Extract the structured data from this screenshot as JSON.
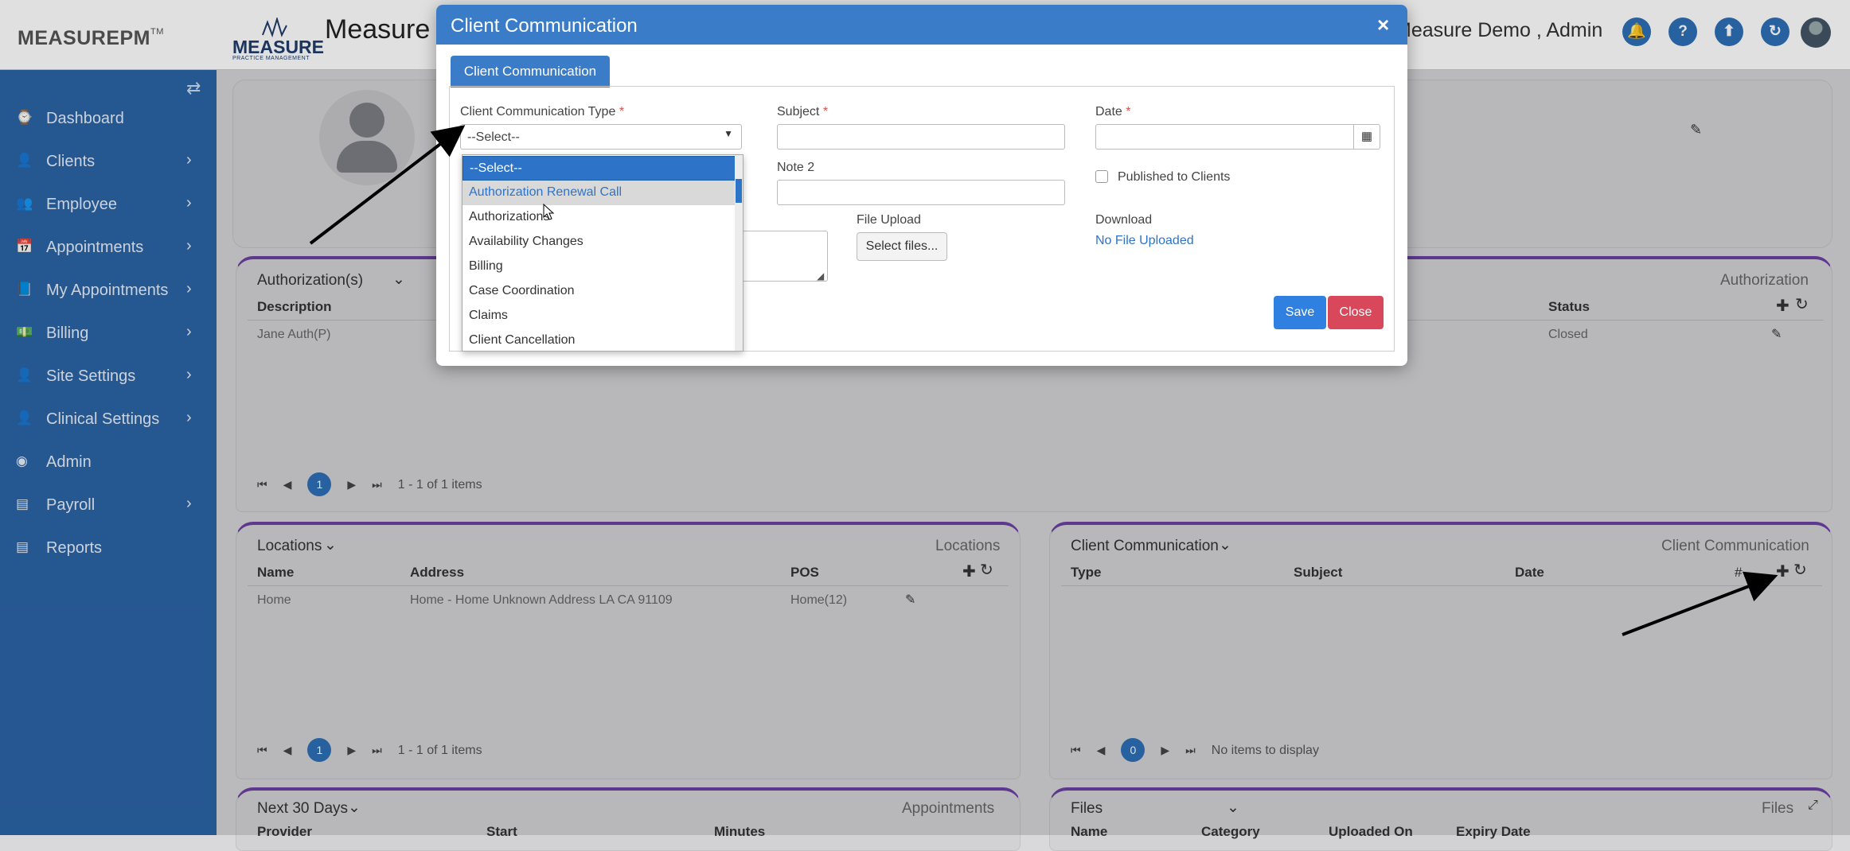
{
  "header": {
    "brand": "MEASUREPM",
    "brand_tm": "TM",
    "logo_word": "MEASURE",
    "logo_sub": "PRACTICE MANAGEMENT",
    "app_title": "Measure",
    "user_label": "Measure Demo , Admin",
    "icons": [
      "bell-icon",
      "help-icon",
      "upload-icon",
      "refresh-icon"
    ],
    "icon_glyphs": [
      "🔔",
      "?",
      "⬆",
      "↻"
    ]
  },
  "sidebar": {
    "items": [
      {
        "label": "Dashboard",
        "icon": "⌚",
        "chev": false
      },
      {
        "label": "Clients",
        "icon": "👤",
        "chev": true
      },
      {
        "label": "Employee",
        "icon": "👥",
        "chev": true
      },
      {
        "label": "Appointments",
        "icon": "📅",
        "chev": true
      },
      {
        "label": "My Appointments",
        "icon": "📘",
        "chev": true
      },
      {
        "label": "Billing",
        "icon": "💵",
        "chev": true
      },
      {
        "label": "Site Settings",
        "icon": "👤",
        "chev": true
      },
      {
        "label": "Clinical Settings",
        "icon": "👤",
        "chev": true
      },
      {
        "label": "Admin",
        "icon": "◉",
        "chev": false
      },
      {
        "label": "Payroll",
        "icon": "▤",
        "chev": true
      },
      {
        "label": "Reports",
        "icon": "▤",
        "chev": false
      }
    ]
  },
  "panels": {
    "authorizations": {
      "title": "Authorization(s)",
      "right": "Authorization",
      "cols": {
        "description": "Description",
        "status": "Status"
      },
      "row": {
        "description": "Jane Auth(P)",
        "status": "Closed"
      },
      "page": "1",
      "info": "1 - 1 of 1 items"
    },
    "locations": {
      "title": "Locations",
      "right": "Locations",
      "cols": {
        "name": "Name",
        "address": "Address",
        "pos": "POS"
      },
      "row": {
        "name": "Home",
        "address": "Home - Home Unknown Address LA CA 91109",
        "pos": "Home(12)"
      },
      "page": "1",
      "info": "1 - 1 of 1 items"
    },
    "client_comm": {
      "title": "Client Communication",
      "right": "Client Communication",
      "cols": {
        "type": "Type",
        "subject": "Subject",
        "date": "Date",
        "num": "#"
      },
      "page": "0",
      "info": "No items to display"
    },
    "next30": {
      "title": "Next 30 Days",
      "right": "Appointments",
      "cols": [
        "Provider",
        "Start",
        "Minutes"
      ]
    },
    "files": {
      "title": "Files",
      "right": "Files",
      "cols": [
        "Name",
        "Category",
        "Uploaded On",
        "Expiry Date"
      ]
    }
  },
  "modal": {
    "title": "Client Communication",
    "close": "×",
    "tab": "Client Communication",
    "type_label": "Client Communication Type",
    "type_value": "--Select--",
    "subject_label": "Subject",
    "date_label": "Date",
    "note2_label": "Note 2",
    "published_label": "Published to Clients",
    "file_upload_label": "File Upload",
    "select_files": "Select files...",
    "download_label": "Download",
    "download_link": "No File Uploaded",
    "save": "Save",
    "close_btn": "Close",
    "required_mark": "*"
  },
  "dropdown": {
    "options": [
      "--Select--",
      "Authorization Renewal Call",
      "Authorizations",
      "Availability Changes",
      "Billing",
      "Case Coordination",
      "Claims",
      "Client Cancellation"
    ],
    "selected_index": 0,
    "hover_index": 1
  },
  "colors": {
    "accent": "#2d6fb5",
    "sidebar": "#2b63a6",
    "panel_border": "#6c3fa3",
    "save": "#2f80e0",
    "close": "#d9485a"
  }
}
